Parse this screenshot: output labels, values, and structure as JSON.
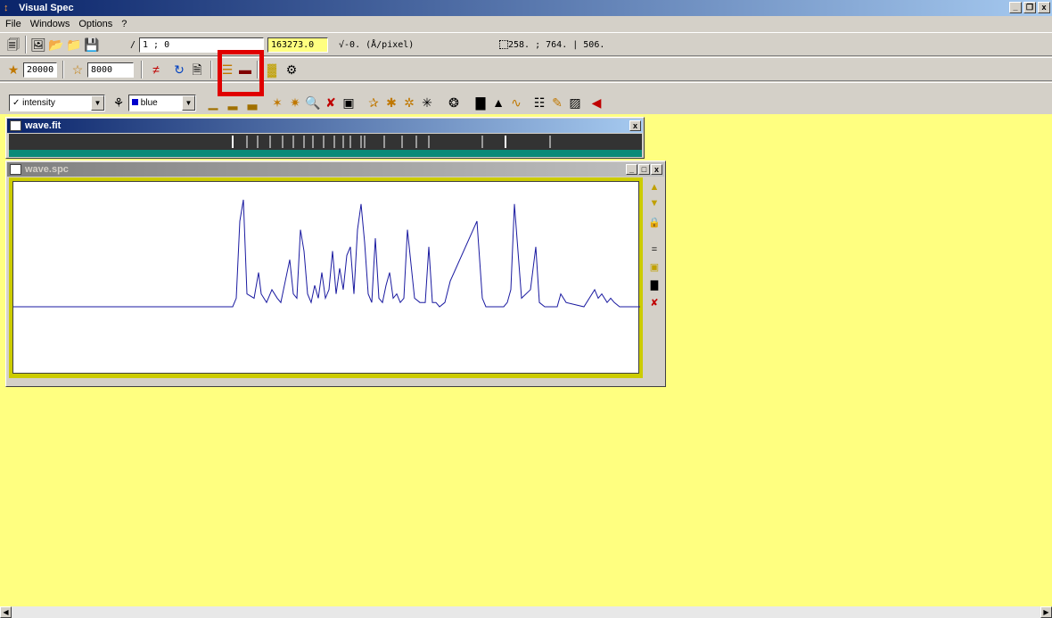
{
  "app": {
    "title": "Visual Spec",
    "title_icon": "app-icon"
  },
  "window_controls": {
    "minimize": "_",
    "restore": "❐",
    "close": "x"
  },
  "menu": [
    "File",
    "Windows",
    "Options",
    "?"
  ],
  "toolbar1": {
    "coord_label": "/",
    "coord_value": "1 ; 0",
    "value_field": "163273.0",
    "dispersion_text": "-0. (Å/pixel)",
    "cursor_text": "258. ; 764. | 506."
  },
  "toolbar2": {
    "field1": "20000",
    "field2": "8000"
  },
  "toolbar3": {
    "series_select": "intensity",
    "color_select": "blue",
    "color_swatch": "#0000cc"
  },
  "windows": {
    "fit": {
      "title": "wave.fit",
      "close": "x"
    },
    "spc": {
      "title": "wave.spc",
      "min": "_",
      "max": "□",
      "close": "x"
    }
  },
  "chart_data": {
    "type": "line",
    "series": [
      {
        "color": "#1a1aa0",
        "x": [
          0,
          140,
          230,
          246,
          250,
          254,
          258,
          262,
          270,
          275,
          278,
          284,
          290,
          296,
          300,
          305,
          310,
          314,
          318,
          322,
          326,
          330,
          334,
          338,
          342,
          346,
          350,
          354,
          358,
          362,
          366,
          370,
          374,
          378,
          382,
          386,
          390,
          394,
          398,
          402,
          406,
          410,
          414,
          418,
          422,
          426,
          430,
          434,
          438,
          442,
          446,
          450,
          456,
          462,
          466,
          470,
          474,
          478,
          484,
          490,
          520,
          526,
          530,
          534,
          540,
          546,
          550,
          554,
          558,
          562,
          570,
          580,
          586,
          590,
          596,
          602,
          606,
          610,
          614,
          620,
          640,
          652,
          656,
          660,
          666,
          670,
          674,
          680,
          686,
          703
        ],
        "y": [
          0,
          0,
          0,
          0,
          2,
          20,
          25,
          3,
          2,
          8,
          3,
          1,
          4,
          2,
          1,
          6,
          11,
          3,
          2,
          18,
          13,
          3,
          1,
          5,
          2,
          8,
          2,
          4,
          13,
          3,
          9,
          4,
          12,
          14,
          3,
          18,
          24,
          15,
          3,
          1,
          16,
          2,
          1,
          5,
          8,
          2,
          3,
          1,
          2,
          18,
          10,
          2,
          1,
          1,
          14,
          1,
          1,
          0,
          1,
          6,
          20,
          2,
          0,
          0,
          0,
          0,
          0,
          1,
          4,
          24,
          2,
          4,
          14,
          1,
          0,
          0,
          0,
          0,
          3,
          1,
          0,
          4,
          2,
          3,
          1,
          2,
          1,
          0,
          0,
          0
        ]
      }
    ]
  }
}
